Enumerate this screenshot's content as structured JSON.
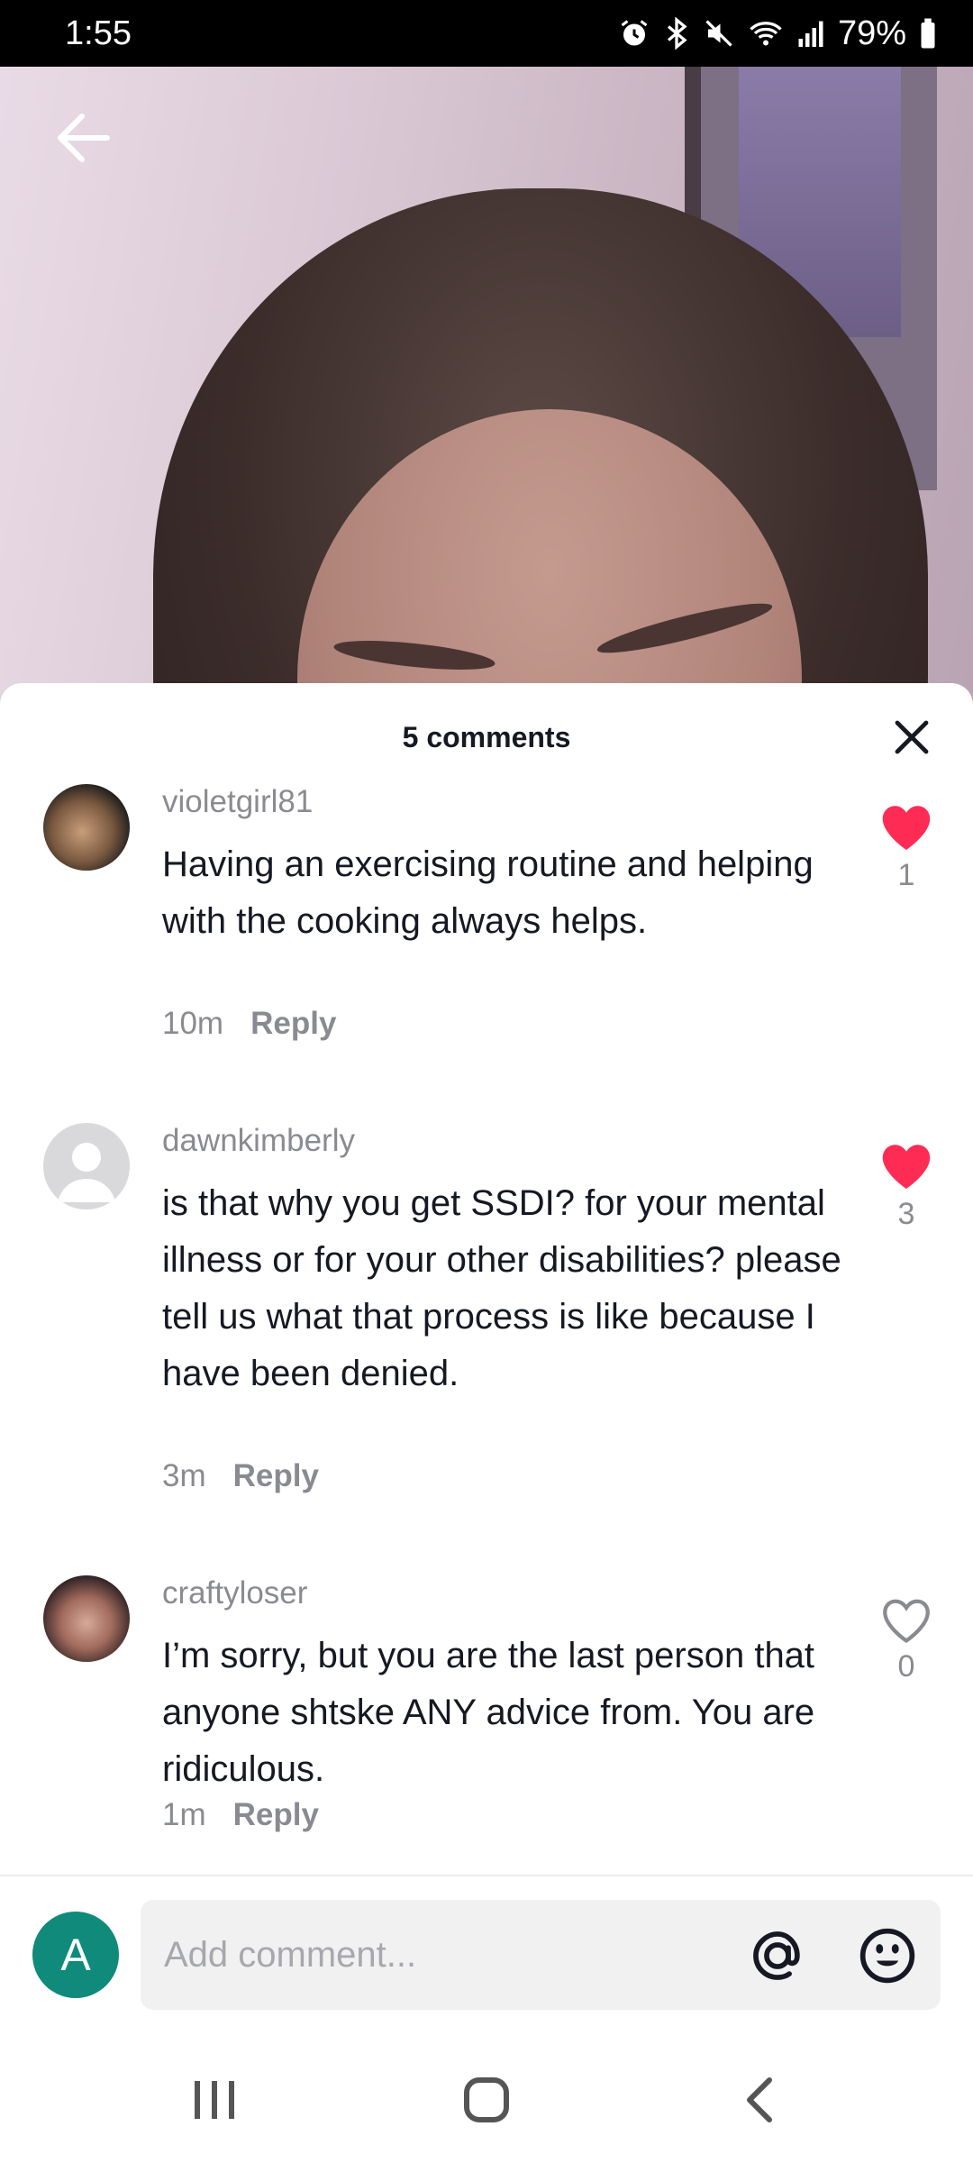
{
  "status_bar": {
    "time": "1:55",
    "battery": "79%",
    "icons": [
      "alarm-icon",
      "bluetooth-icon",
      "mute-icon",
      "wifi-icon",
      "signal-icon",
      "battery-icon"
    ]
  },
  "header": {
    "back_icon": "back-arrow-icon"
  },
  "sheet": {
    "title": "5 comments",
    "close_icon": "close-icon"
  },
  "comments": [
    {
      "username": "violetgirl81",
      "text": "Having an exercising routine and helping with the cooking always helps.",
      "time": "10m",
      "reply_label": "Reply",
      "likes": "1",
      "liked": true
    },
    {
      "username": "dawnkimberly",
      "text": "is that why you get SSDI? for your mental illness or for your other disabilities? please tell us what that process is like because I have been denied.",
      "time": "3m",
      "reply_label": "Reply",
      "likes": "3",
      "liked": true
    },
    {
      "username": "craftyloser",
      "text": "I’m sorry, but you are the last person that anyone shtske ANY advice from. You are ridiculous.",
      "time": "1m",
      "reply_label": "Reply",
      "likes": "0",
      "liked": false
    }
  ],
  "composer": {
    "avatar_letter": "A",
    "placeholder": "Add comment...",
    "mention_icon": "at-icon",
    "emoji_icon": "emoji-icon"
  },
  "colors": {
    "like": "#fe2c55",
    "avatar_bg": "#0f8a7b",
    "text_primary": "#161823",
    "text_secondary": "#8a8b91"
  }
}
